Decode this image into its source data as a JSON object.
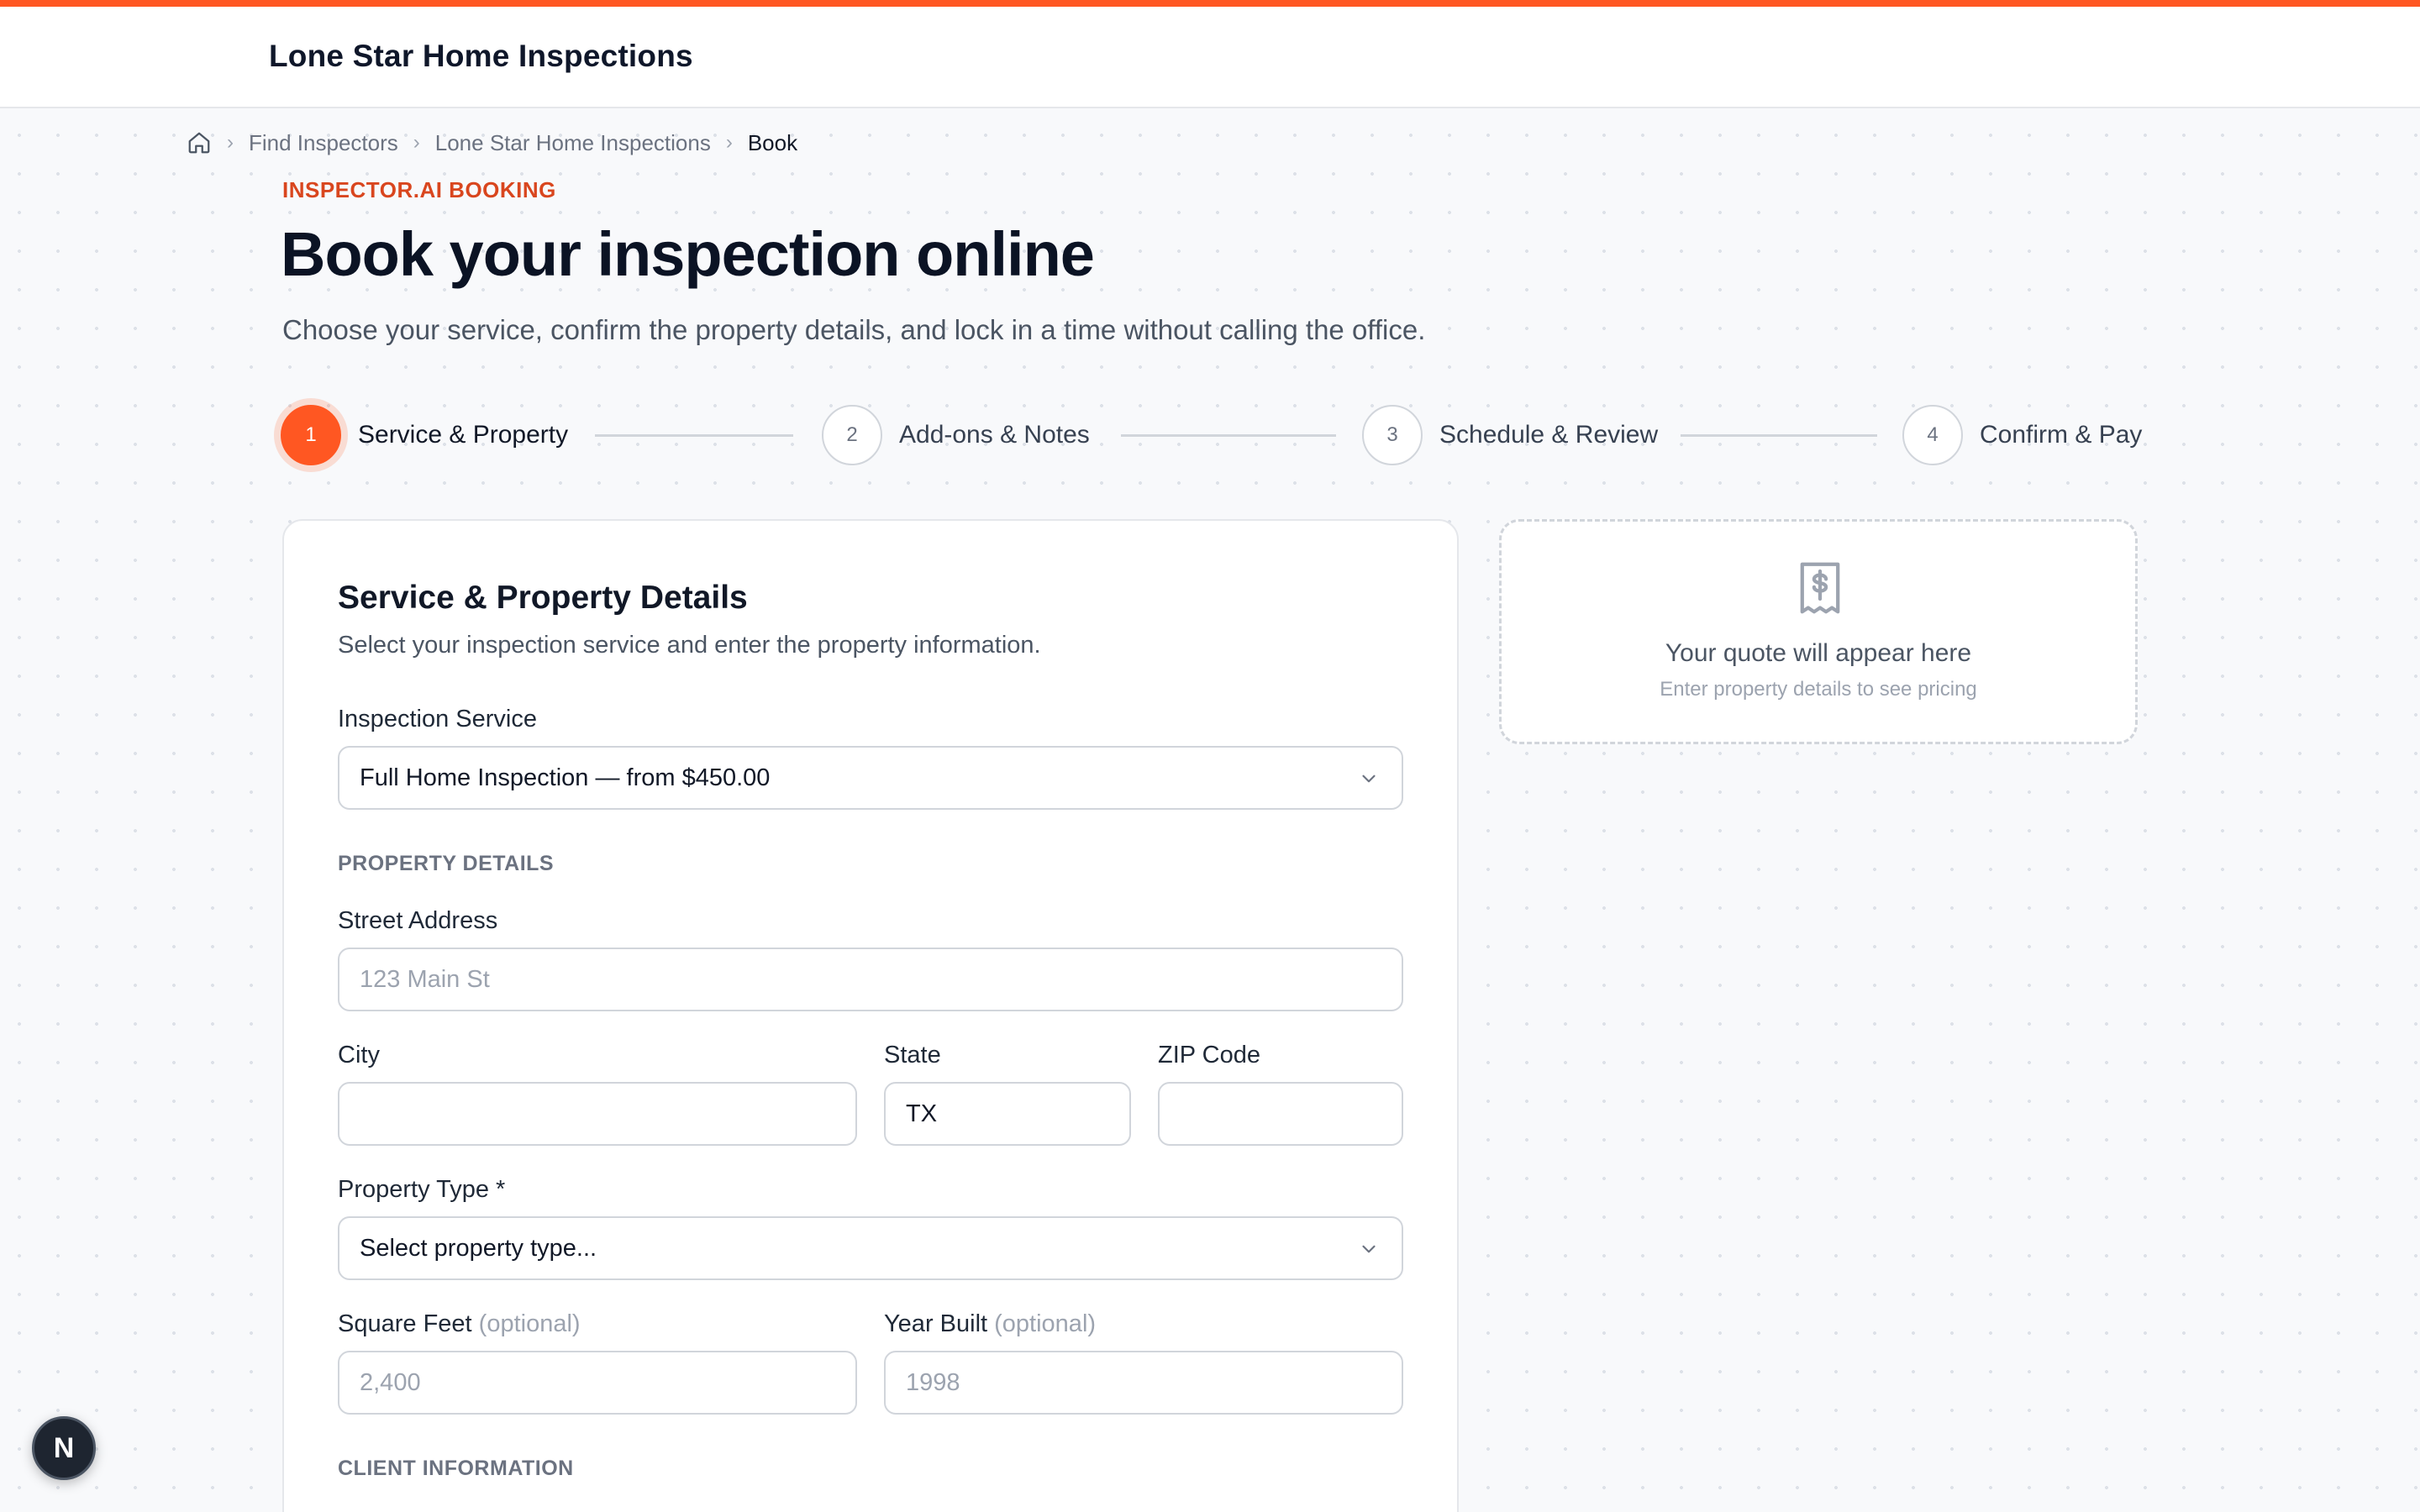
{
  "header": {
    "brand": "Lone Star Home Inspections"
  },
  "breadcrumb": {
    "home_icon": "home-icon",
    "items": [
      "Find Inspectors",
      "Lone Star Home Inspections",
      "Book"
    ],
    "separator": "›"
  },
  "hero": {
    "eyebrow": "INSPECTOR.AI BOOKING",
    "title": "Book your inspection online",
    "subtitle": "Choose your service, confirm the property details, and lock in a time without calling the office."
  },
  "stepper": {
    "steps": [
      {
        "number": "1",
        "label": "Service & Property",
        "active": true
      },
      {
        "number": "2",
        "label": "Add-ons & Notes",
        "active": false
      },
      {
        "number": "3",
        "label": "Schedule & Review",
        "active": false
      },
      {
        "number": "4",
        "label": "Confirm & Pay",
        "active": false
      }
    ]
  },
  "form": {
    "title": "Service & Property Details",
    "description": "Select your inspection service and enter the property information.",
    "service": {
      "label": "Inspection Service",
      "value": "Full Home Inspection — from $450.00"
    },
    "property_section": "PROPERTY DETAILS",
    "street": {
      "label": "Street Address",
      "value": "",
      "placeholder": "123 Main St"
    },
    "city": {
      "label": "City",
      "value": "",
      "placeholder": ""
    },
    "state": {
      "label": "State",
      "value": "TX"
    },
    "zip": {
      "label": "ZIP Code",
      "value": "",
      "placeholder": ""
    },
    "property_type": {
      "label": "Property Type *",
      "value": "Select property type..."
    },
    "square_feet": {
      "label": "Square Feet",
      "optional": "(optional)",
      "placeholder": "2,400"
    },
    "year_built": {
      "label": "Year Built",
      "optional": "(optional)",
      "placeholder": "1998"
    },
    "client_section": "CLIENT INFORMATION"
  },
  "quote": {
    "icon": "receipt-dollar-icon",
    "title": "Your quote will appear here",
    "subtitle": "Enter property details to see pricing"
  },
  "fab": {
    "label": "N"
  },
  "colors": {
    "accent": "#ff5722",
    "eyebrow": "#d9461e",
    "text": "#111827",
    "muted": "#6b7280"
  }
}
